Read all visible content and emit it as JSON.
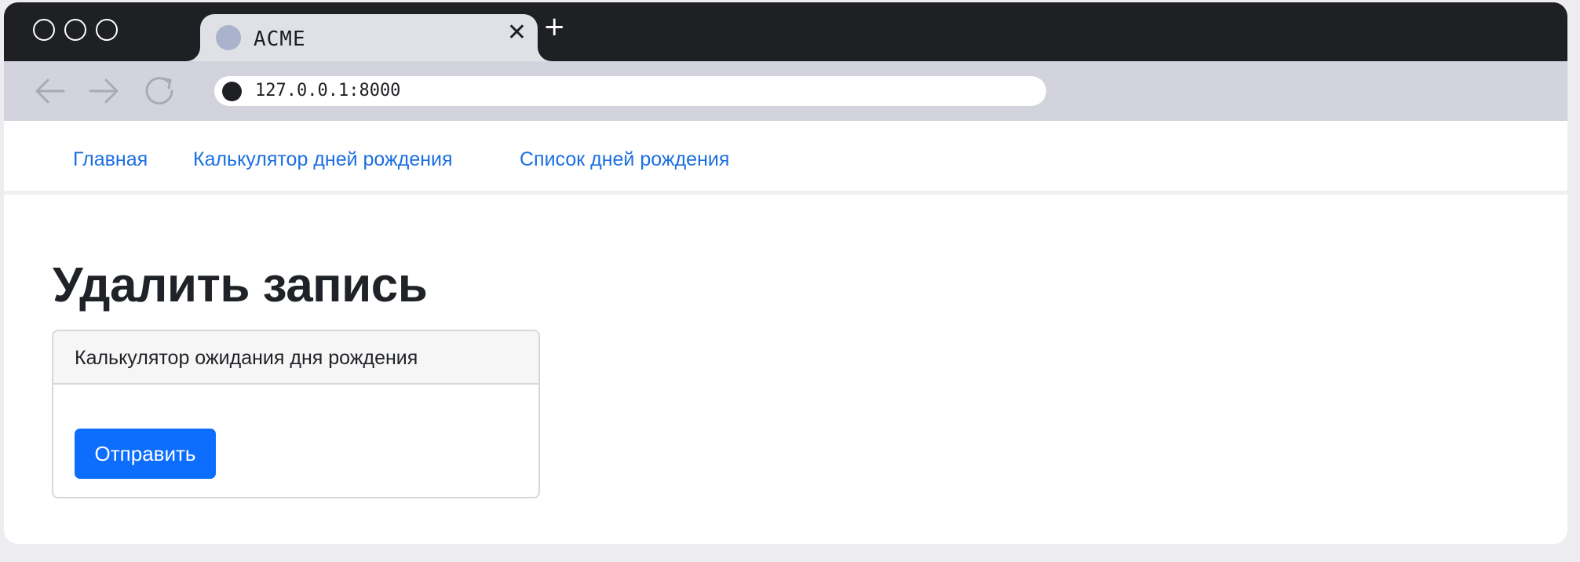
{
  "browser": {
    "tab": {
      "title": "ACME",
      "close_glyph": "✕"
    },
    "new_tab_glyph": "+",
    "address": {
      "url": "127.0.0.1:8000"
    },
    "icons": {
      "back": "back-arrow-icon",
      "forward": "forward-arrow-icon",
      "reload": "reload-icon",
      "favicon": "favicon-icon",
      "site_info": "site-info-icon"
    }
  },
  "navbar": {
    "links": [
      {
        "label": "Главная"
      },
      {
        "label": "Калькулятор дней рождения"
      },
      {
        "label": "Список дней рождения"
      }
    ]
  },
  "main": {
    "title": "Удалить запись",
    "card": {
      "header": "Калькулятор ожидания дня рождения",
      "submit_label": "Отправить"
    }
  },
  "colors": {
    "link": "#1b6fe0",
    "primary_button": "#0d6efd",
    "titlebar": "#1f2024",
    "toolbar": "#d2d3dc"
  }
}
